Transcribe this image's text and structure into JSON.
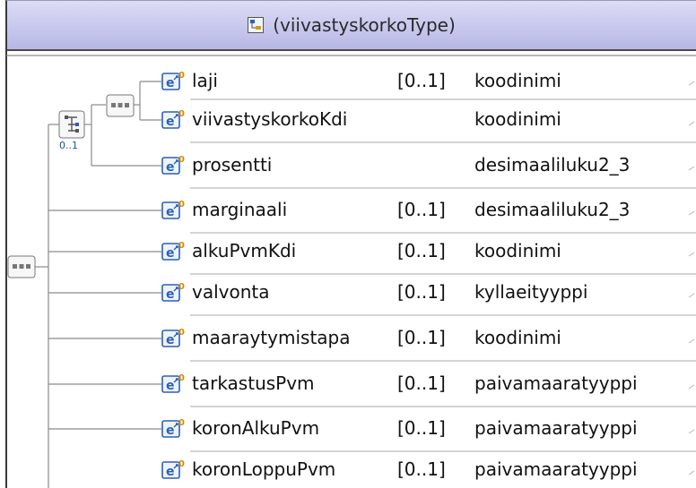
{
  "header": {
    "title": "(viivastyskorkoType)",
    "icon": "complex-type-icon"
  },
  "choice": {
    "cardinality": "0..1"
  },
  "rows": [
    {
      "name": "laji",
      "cardinality": "[0..1]",
      "type": "koodinimi"
    },
    {
      "name": "viivastyskorkoKdi",
      "cardinality": "",
      "type": "koodinimi"
    },
    {
      "name": "prosentti",
      "cardinality": "",
      "type": "desimaaliluku2_3"
    },
    {
      "name": "marginaali",
      "cardinality": "[0..1]",
      "type": "desimaaliluku2_3"
    },
    {
      "name": "alkuPvmKdi",
      "cardinality": "[0..1]",
      "type": "koodinimi"
    },
    {
      "name": "valvonta",
      "cardinality": "[0..1]",
      "type": "kyllaeityyppi"
    },
    {
      "name": "maaraytymistapa",
      "cardinality": "[0..1]",
      "type": "koodinimi"
    },
    {
      "name": "tarkastusPvm",
      "cardinality": "[0..1]",
      "type": "paivamaaratyyppi"
    },
    {
      "name": "koronAlkuPvm",
      "cardinality": "[0..1]",
      "type": "paivamaaratyyppi"
    },
    {
      "name": "koronLoppuPvm",
      "cardinality": "[0..1]",
      "type": "paivamaaratyyppi"
    }
  ],
  "colors": {
    "header": "#c6c6ee",
    "line": "#8a8a8a",
    "icon": "#2a60b8",
    "badge": "#d08a00"
  }
}
